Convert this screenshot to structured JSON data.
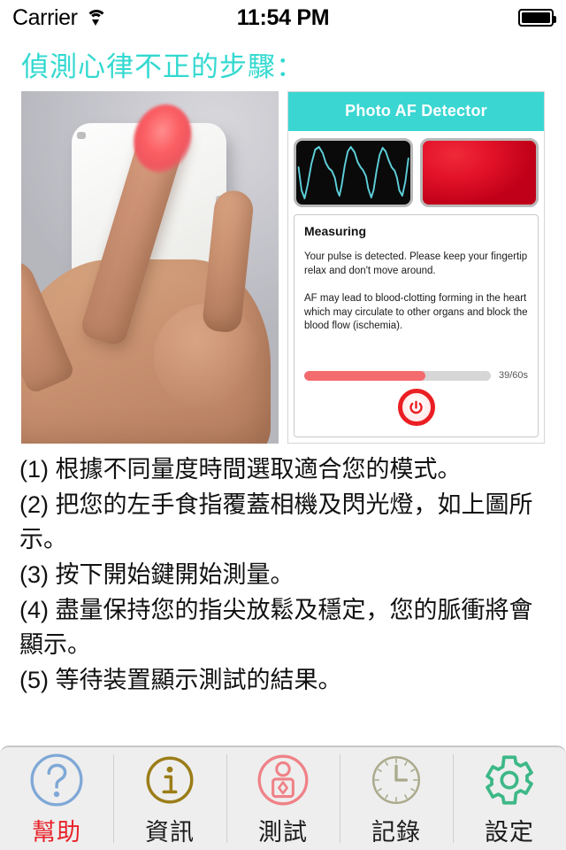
{
  "status_bar": {
    "carrier": "Carrier",
    "wifi_icon": "wifi-icon",
    "time": "11:54 PM",
    "battery_icon": "battery-full-icon"
  },
  "page_title": "偵測心律不正的步驟：",
  "title_color": "#33d9d0",
  "photo": {
    "name": "fingertip-on-camera-photo",
    "description": "Hand holding a white smartphone with index fingertip covering the camera and flash, fingertip glowing red"
  },
  "app_mock": {
    "header_title": "Photo AF Detector",
    "header_color": "#3ad6d2",
    "waveform_tile": {
      "name": "ppg-waveform-tile",
      "background": "#0a0a0a",
      "line_color": "#5ed0da"
    },
    "flash_tile": {
      "name": "camera-flash-tile",
      "color": "#e3132a"
    },
    "card": {
      "title": "Measuring",
      "paragraph_1": "Your pulse is detected. Please keep your fingertip relax and don't move around.",
      "paragraph_2": "AF may lead to blood-clotting forming in the heart which may circulate to other organs and block the blood flow (ischemia).",
      "progress": {
        "percent": 65,
        "label": "39/60s",
        "fill_color": "#f46b6e",
        "track_color": "#d6d6d6"
      },
      "power_button": {
        "name": "power-button",
        "color": "#ea1e23"
      }
    }
  },
  "steps": [
    "(1) 根據不同量度時間選取適合您的模式。",
    "(2) 把您的左手食指覆蓋相機及閃光燈，如上圖所示。",
    "(3) 按下開始鍵開始測量。",
    "(4) 盡量保持您的指尖放鬆及穩定，您的脈衝將會顯示。",
    "(5) 等待装置顯示測試的結果。"
  ],
  "tabbar": {
    "items": [
      {
        "label": "幫助",
        "icon": "question-mark-circle-icon",
        "color": "#7fa8d6",
        "active": true
      },
      {
        "label": "資訊",
        "icon": "info-circle-icon",
        "color": "#9b7d18",
        "active": false
      },
      {
        "label": "測試",
        "icon": "person-test-circle-icon",
        "color": "#ef8287",
        "active": false
      },
      {
        "label": "記錄",
        "icon": "clock-icon",
        "color": "#a9aa8a",
        "active": false
      },
      {
        "label": "設定",
        "icon": "gear-icon",
        "color": "#3db887",
        "active": false
      }
    ],
    "active_label_color": "#e8232a",
    "background": "#eeeeee"
  }
}
